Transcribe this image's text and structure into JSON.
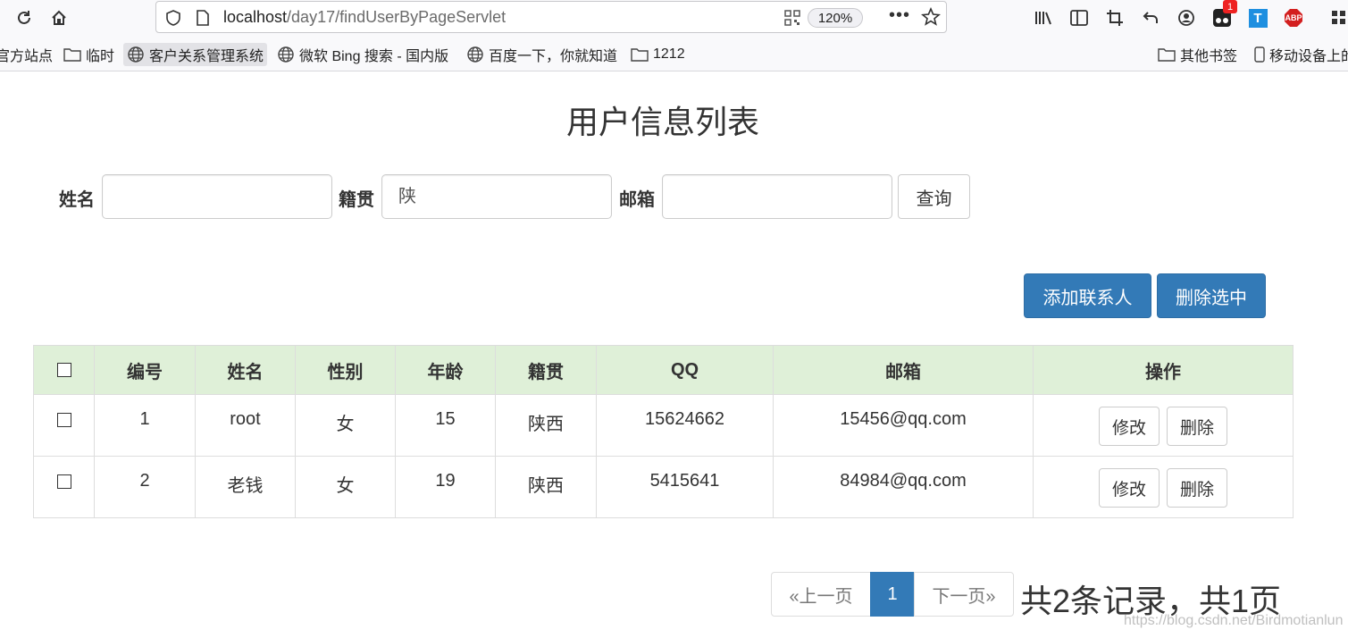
{
  "browser": {
    "url_host": "localhost",
    "url_path": "/day17/findUserByPageServlet",
    "zoom": "120%",
    "ext_badge_count": "1",
    "ext_t_label": "T",
    "ext_abp_label": "ABP",
    "bookmarks": [
      {
        "label": "官方站点",
        "icon": "folder-icon"
      },
      {
        "label": "临时",
        "icon": "folder-icon"
      },
      {
        "label": "客户关系管理系统",
        "icon": "globe-icon"
      },
      {
        "label": "微软 Bing 搜索 - 国内版",
        "icon": "globe-icon"
      },
      {
        "label": "百度一下，你就知道",
        "icon": "globe-icon"
      },
      {
        "label": "1212",
        "icon": "folder-icon"
      },
      {
        "label": "其他书签",
        "icon": "folder-icon"
      },
      {
        "label": "移动设备上的",
        "icon": "mobile-icon"
      }
    ]
  },
  "page": {
    "title": "用户信息列表",
    "search": {
      "name_label": "姓名",
      "name_value": "",
      "origin_label": "籍贯",
      "origin_value": "陕",
      "email_label": "邮箱",
      "email_value": "",
      "submit_label": "查询"
    },
    "actions": {
      "add_label": "添加联系人",
      "delete_selected_label": "删除选中"
    },
    "table": {
      "headers": [
        "编号",
        "姓名",
        "性别",
        "年龄",
        "籍贯",
        "QQ",
        "邮箱",
        "操作"
      ],
      "rows": [
        {
          "id": "1",
          "name": "root",
          "gender": "女",
          "age": "15",
          "origin": "陕西",
          "qq": "15624662",
          "email": "15456@qq.com"
        },
        {
          "id": "2",
          "name": "老钱",
          "gender": "女",
          "age": "19",
          "origin": "陕西",
          "qq": "5415641",
          "email": "84984@qq.com"
        }
      ],
      "edit_label": "修改",
      "delete_label": "删除"
    },
    "pagination": {
      "prev_label": "«上一页",
      "current_page": "1",
      "next_label": "下一页»",
      "summary": "共2条记录，共1页"
    },
    "watermark": "https://blog.csdn.net/Birdmotianlun"
  },
  "colors": {
    "primary": "#337ab7",
    "table_header_bg": "#dff0d8",
    "chrome_bg": "#f9f9fb"
  }
}
